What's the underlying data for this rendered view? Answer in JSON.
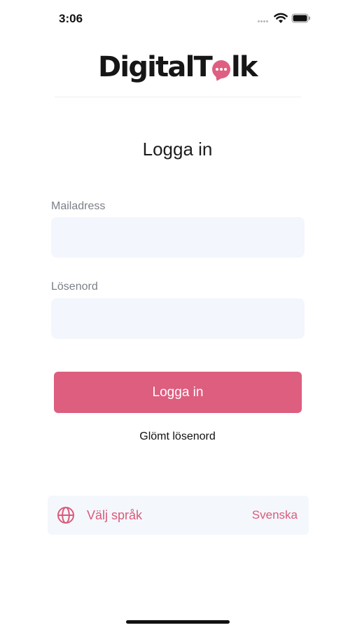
{
  "status_bar": {
    "time": "3:06",
    "icons": [
      "signal-dots-icon",
      "wifi-icon",
      "battery-icon"
    ]
  },
  "logo": {
    "part1": "Digital",
    "part2": "T",
    "part3": "lk",
    "bubble_icon": "chat-bubble-icon"
  },
  "page_title": "Logga in",
  "form": {
    "email_label": "Mailadress",
    "email_value": "",
    "password_label": "Lösenord",
    "password_value": "",
    "login_button": "Logga in",
    "forgot_link": "Glömt lösenord"
  },
  "language": {
    "icon": "globe-icon",
    "label": "Välj språk",
    "value": "Svenska"
  },
  "colors": {
    "accent": "#dd5e7f",
    "field_background": "#f3f6fc",
    "label_gray": "#7b7f87"
  }
}
